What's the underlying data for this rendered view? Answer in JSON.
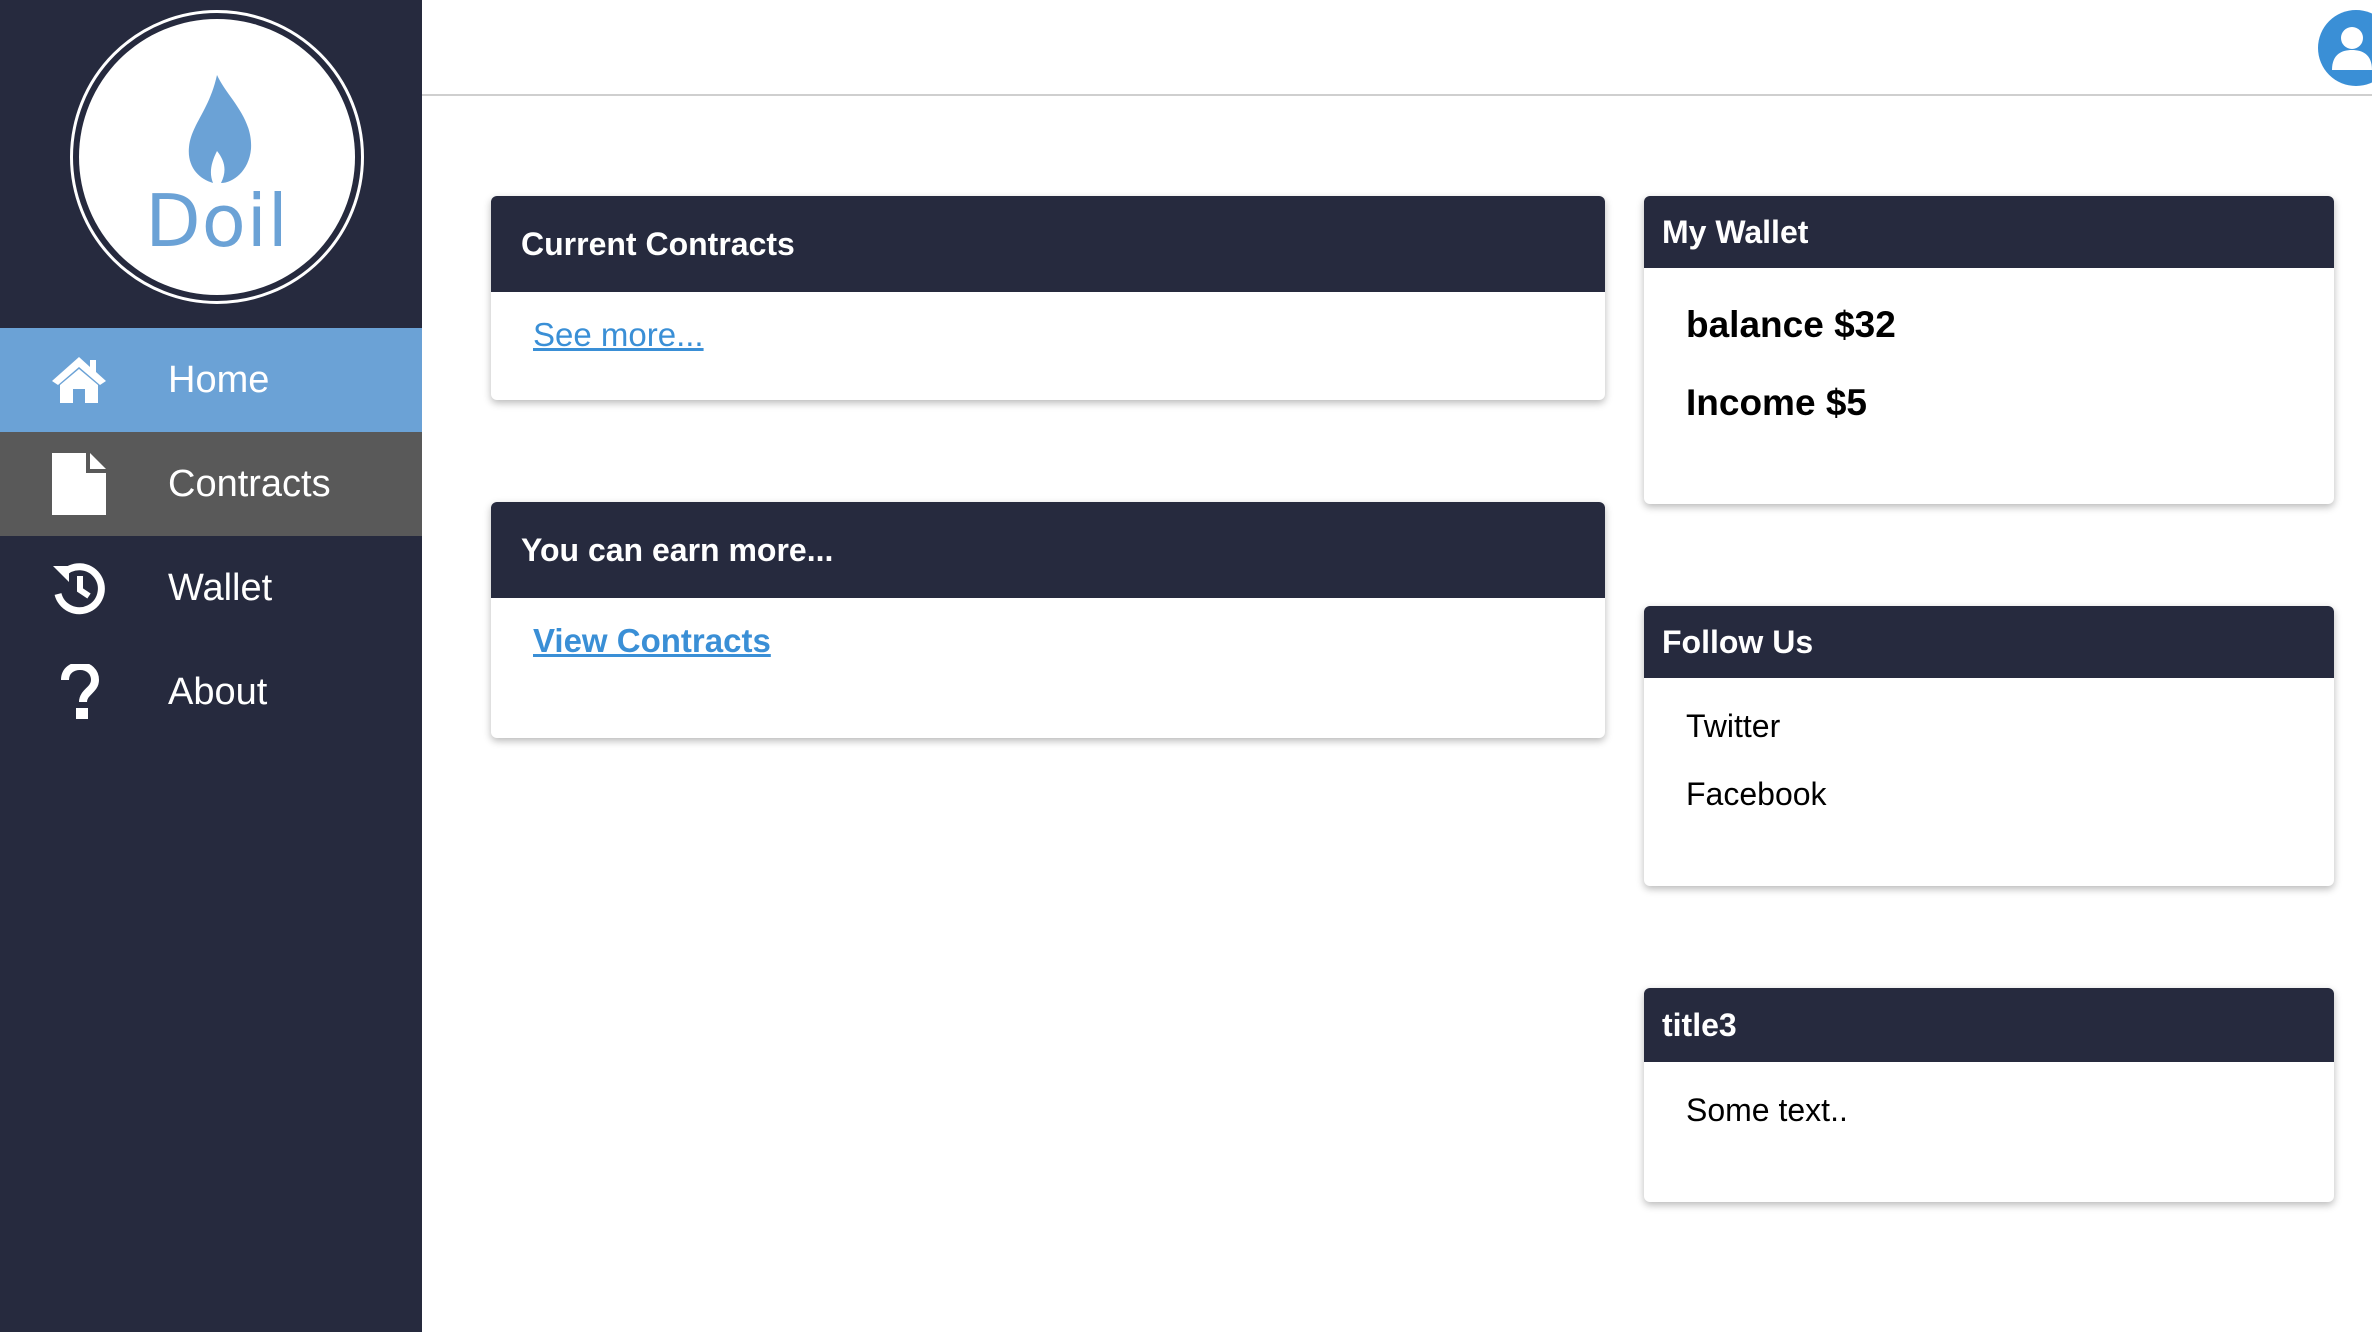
{
  "brand": {
    "name": "Doil",
    "accent": "#6ba2d6",
    "sidebar_bg": "#262a3e"
  },
  "sidebar": {
    "items": [
      {
        "label": "Home",
        "icon": "home-icon",
        "state": "active"
      },
      {
        "label": "Contracts",
        "icon": "document-icon",
        "state": "hover"
      },
      {
        "label": "Wallet",
        "icon": "history-icon",
        "state": "normal"
      },
      {
        "label": "About",
        "icon": "question-icon",
        "state": "normal"
      }
    ]
  },
  "header": {
    "avatar_icon": "user-icon"
  },
  "cards": {
    "current_contracts": {
      "title": "Current Contracts",
      "link": "See more..."
    },
    "earn_more": {
      "title": "You can earn more...",
      "link": "View Contracts"
    },
    "wallet": {
      "title": "My Wallet",
      "balance": "balance $32",
      "income": "Income $5"
    },
    "follow": {
      "title": "Follow Us",
      "twitter": "Twitter",
      "facebook": "Facebook"
    },
    "title3": {
      "title": "title3",
      "text": "Some text.."
    }
  }
}
